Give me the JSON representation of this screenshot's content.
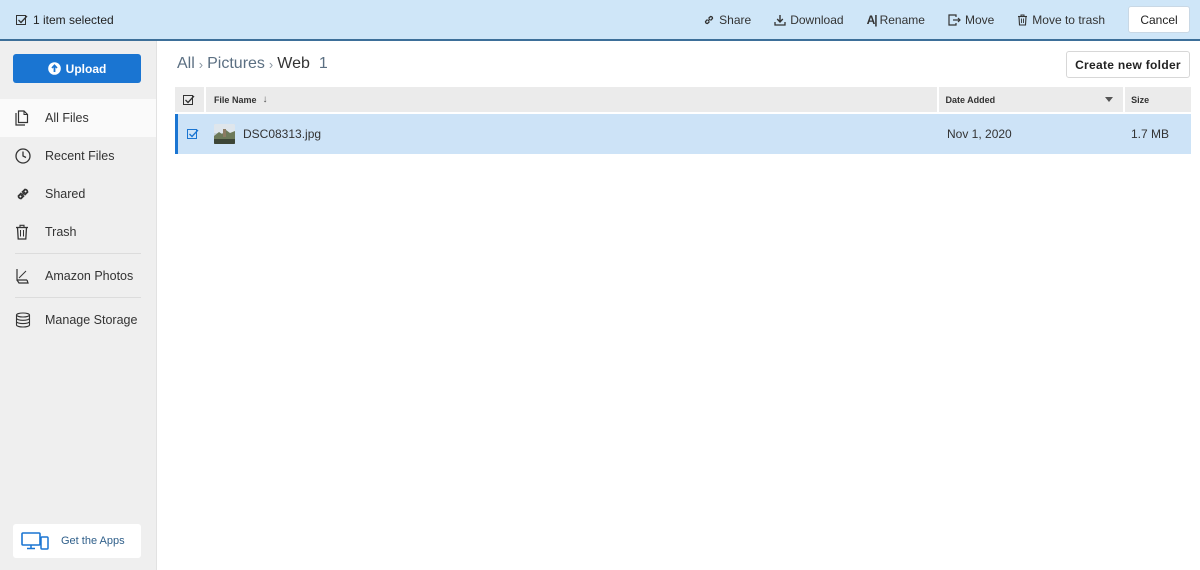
{
  "selection_bar": {
    "status": "1 item selected",
    "actions": {
      "share": "Share",
      "download": "Download",
      "rename": "Rename",
      "move": "Move",
      "trash": "Move to trash"
    },
    "cancel": "Cancel"
  },
  "sidebar": {
    "upload_label": "Upload",
    "items": [
      {
        "label": "All Files",
        "icon": "files-icon",
        "active": true
      },
      {
        "label": "Recent Files",
        "icon": "clock-icon"
      },
      {
        "label": "Shared",
        "icon": "link-icon"
      },
      {
        "label": "Trash",
        "icon": "trash-icon"
      },
      {
        "label": "Amazon Photos",
        "icon": "photos-icon"
      },
      {
        "label": "Manage Storage",
        "icon": "database-icon"
      }
    ],
    "apps_label": "Get the Apps"
  },
  "breadcrumb": {
    "root": "All",
    "parent": "Pictures",
    "current": "Web",
    "count": "1"
  },
  "create_folder_label": "Create new folder",
  "table": {
    "columns": {
      "name": "File Name",
      "date": "Date Added",
      "size": "Size"
    },
    "rows": [
      {
        "name": "DSC08313.jpg",
        "date": "Nov 1, 2020",
        "size": "1.7 MB",
        "selected": true
      }
    ]
  },
  "colors": {
    "accent": "#1a75d2",
    "selection_bg": "#cde3f7",
    "topbar_bg": "#cfe6f8"
  }
}
